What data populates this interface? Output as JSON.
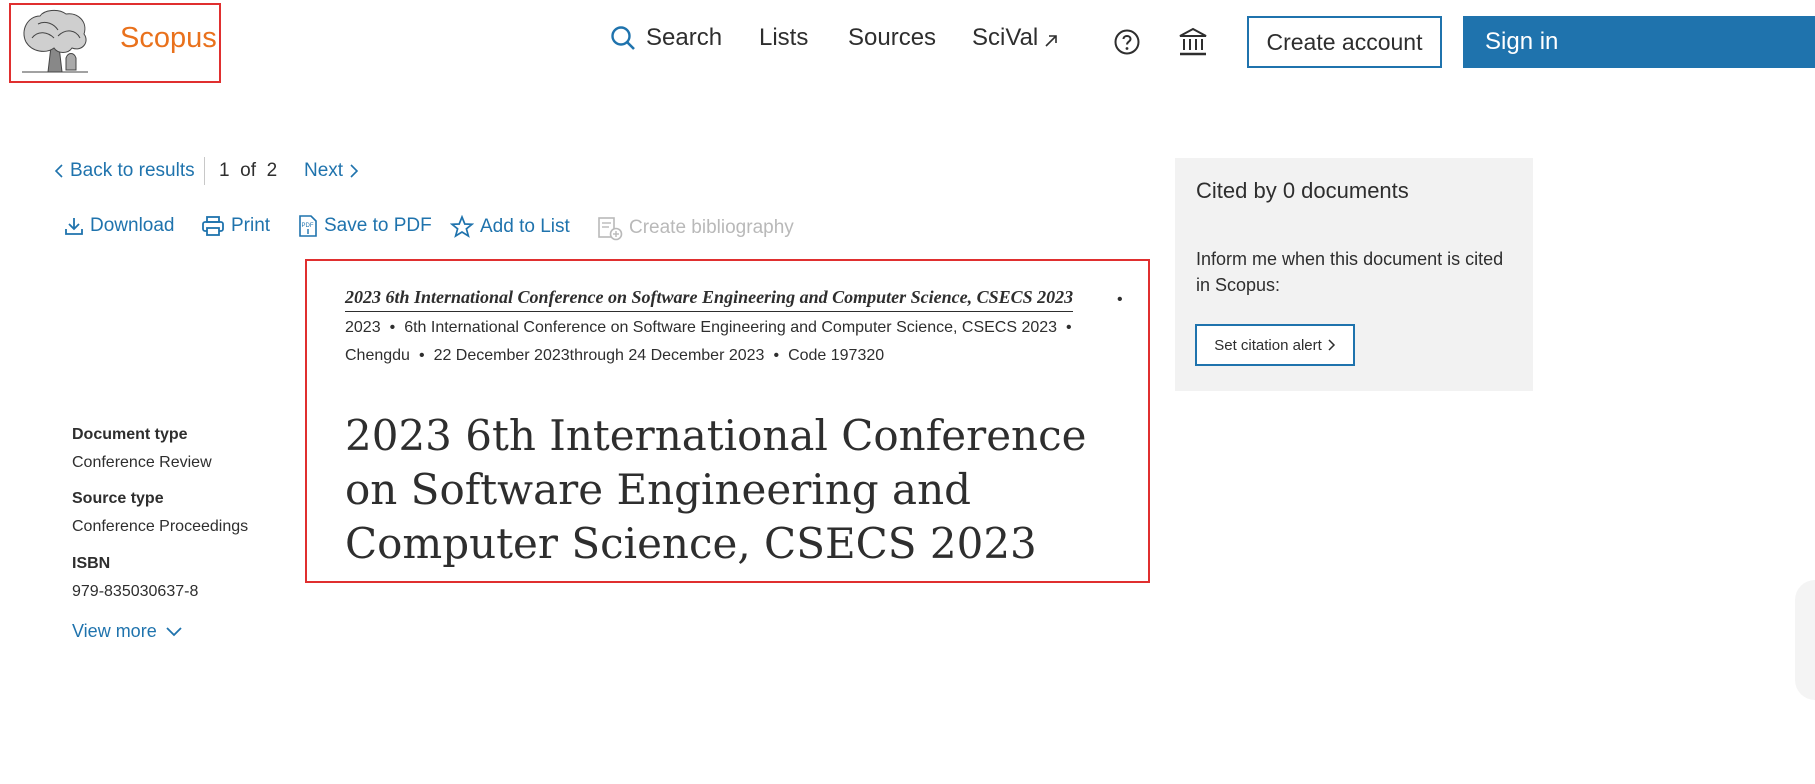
{
  "header": {
    "logo_text": "Scopus",
    "nav": {
      "search": "Search",
      "lists": "Lists",
      "sources": "Sources",
      "scival": "SciVal"
    },
    "create_account": "Create account",
    "sign_in": "Sign in"
  },
  "navigation": {
    "back": "Back to results",
    "current": "1",
    "of": "of",
    "total": "2",
    "next": "Next"
  },
  "toolbar": {
    "download": "Download",
    "print": "Print",
    "save_pdf": "Save to PDF",
    "add_list": "Add to List",
    "create_bibliography": "Create bibliography"
  },
  "document": {
    "source_title": "2023 6th International Conference on Software Engineering and Computer Science, CSECS 2023",
    "year": "2023",
    "conference_name": "6th International Conference on Software Engineering and Computer Science, CSECS 2023",
    "location": "Chengdu",
    "dates": "22 December 2023through 24 December 2023",
    "code": "Code 197320",
    "title": "2023 6th International Conference on Software Engineering and Computer Science, CSECS 2023"
  },
  "details": {
    "document_type_label": "Document type",
    "document_type_value": "Conference Review",
    "source_type_label": "Source type",
    "source_type_value": "Conference Proceedings",
    "isbn_label": "ISBN",
    "isbn_value": "979-835030637-8",
    "view_more": "View more"
  },
  "cited": {
    "title": "Cited by 0 documents",
    "description": "Inform me when this document is cited in Scopus:",
    "alert_button": "Set citation alert"
  },
  "colors": {
    "brand_orange": "#e9711c",
    "link_blue": "#1f73ad",
    "highlight_red": "#e02f2f",
    "panel_grey": "#f2f2f2",
    "disabled_grey": "#b9b9b9"
  }
}
